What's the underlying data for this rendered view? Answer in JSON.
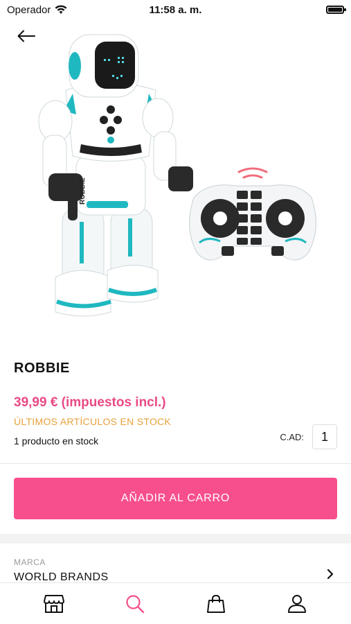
{
  "status_bar": {
    "carrier": "Operador",
    "time": "11:58 a. m.",
    "battery_level": 1.0
  },
  "header": {
    "back_icon": "arrow-left-icon"
  },
  "product": {
    "name": "ROBBIE",
    "price": "39,99 € (impuestos incl.)",
    "stock_label": "ÚLTIMOS ARTÍCULOS EN STOCK",
    "stock_count": "1 producto en stock",
    "quantity_label": "C.AD:",
    "quantity_value": "1",
    "add_to_cart_label": "AÑADIR AL CARRO",
    "brand_label": "MARCA",
    "brand_value": "WORLD BRANDS"
  },
  "colors": {
    "accent": "#f74f8e",
    "price": "#e94a87",
    "stock_warning": "#e6a13a",
    "robot_teal": "#1fb8c0"
  },
  "tab_bar": {
    "items": [
      {
        "icon": "store-icon",
        "active": false
      },
      {
        "icon": "search-icon",
        "active": true
      },
      {
        "icon": "shopping-bag-icon",
        "active": false
      },
      {
        "icon": "user-icon",
        "active": false
      }
    ]
  }
}
